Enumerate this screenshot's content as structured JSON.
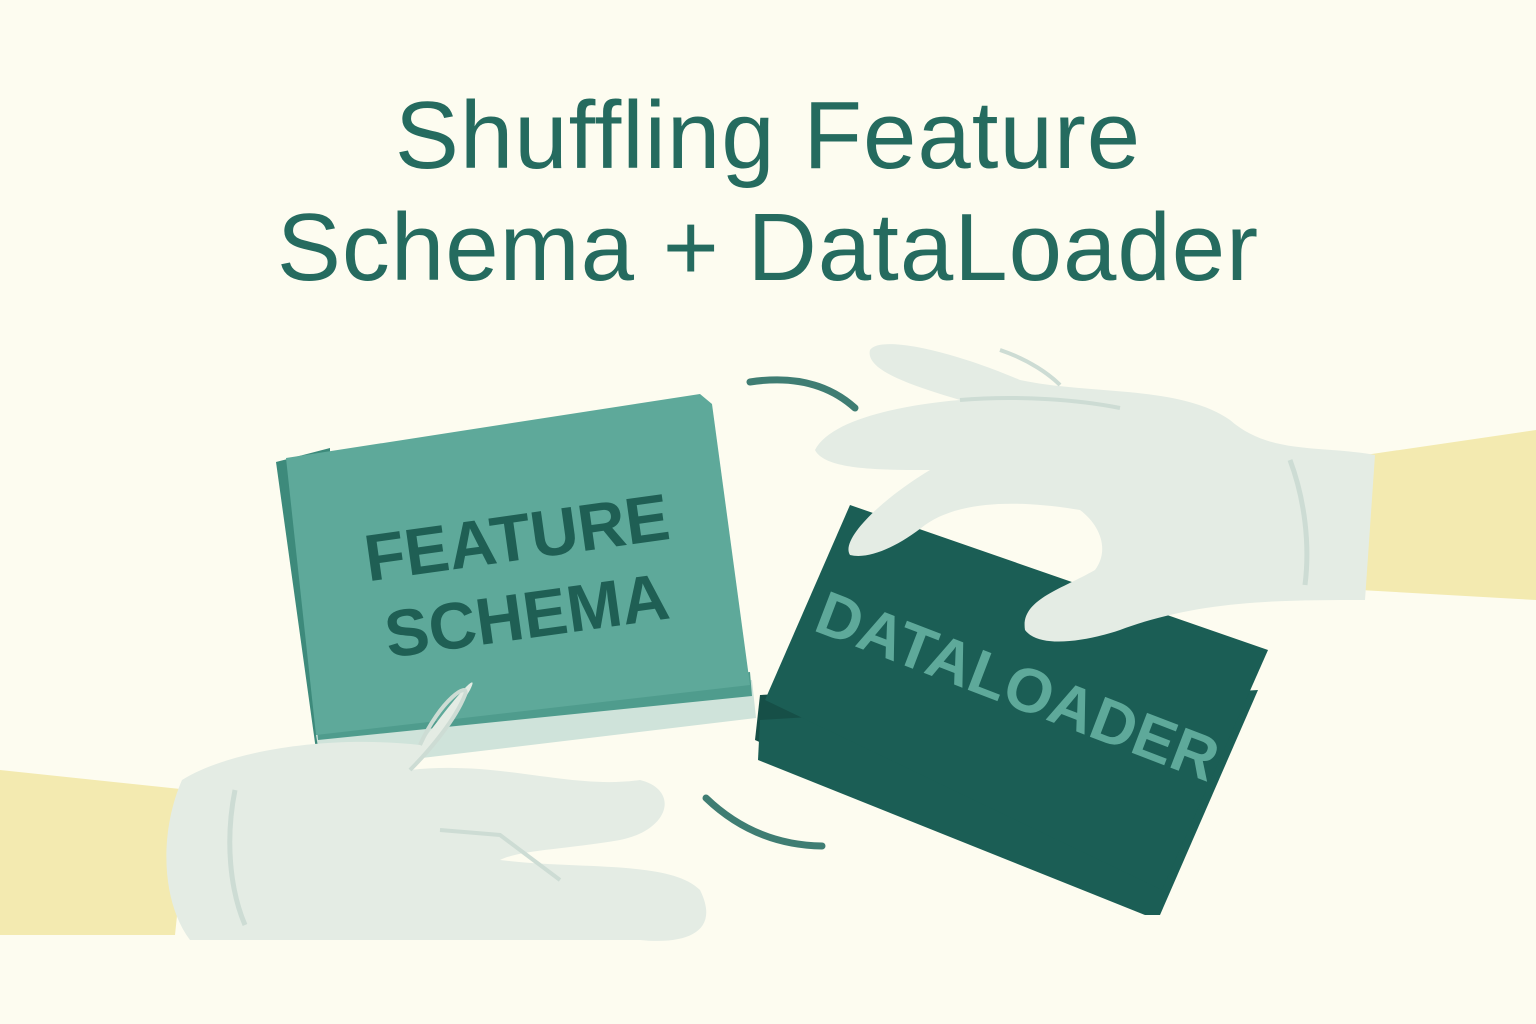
{
  "title": {
    "line1": "Shuffling Feature",
    "line2": "Schema + DataLoader"
  },
  "feature_book": {
    "line1": "FEATURE",
    "line2": "SCHEMA"
  },
  "dataloader_book": {
    "label": "DATALOADER"
  },
  "colors": {
    "background": "#fdfcf0",
    "title": "#256b5f",
    "feature_book": "#5ea99a",
    "feature_text": "#1f5f54",
    "dataloader_book": "#1b5e55",
    "dataloader_text": "#5ea99a",
    "glove": "#e4ece4",
    "sleeve": "#f3eab0"
  }
}
